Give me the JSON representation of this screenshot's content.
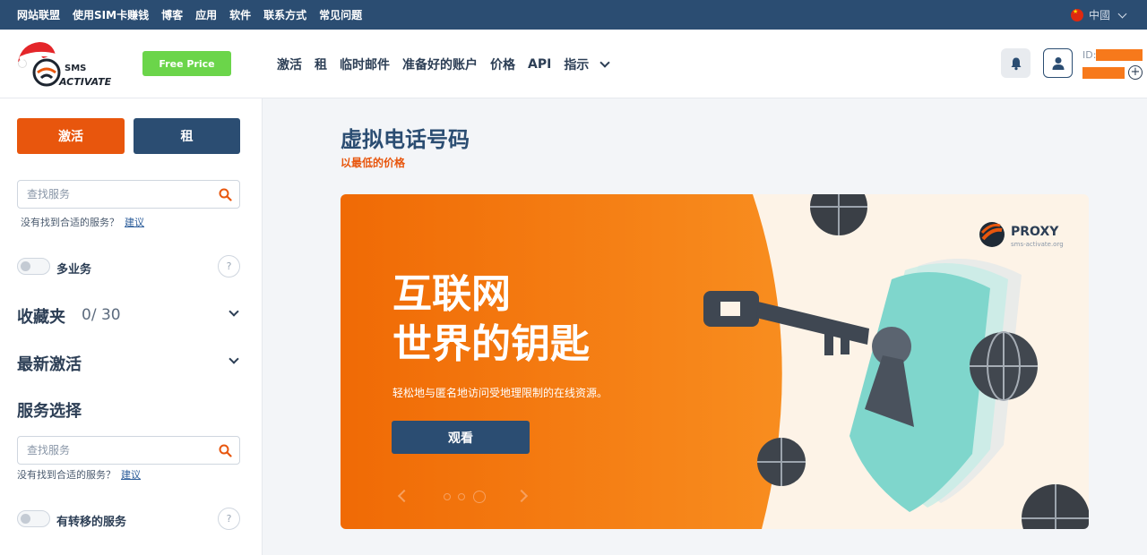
{
  "topbar": {
    "links": [
      "网站联盟",
      "使用SIM卡赚钱",
      "博客",
      "应用",
      "软件",
      "联系方式",
      "常见问题"
    ],
    "language": "中國"
  },
  "header": {
    "logo_text_top": "SMS",
    "logo_text_bottom": "ACTIVATE",
    "free_price_label": "Free Price",
    "nav": [
      "激活",
      "租",
      "临时邮件",
      "准备好的账户",
      "价格",
      "API",
      "指示"
    ],
    "id_label": "ID:",
    "plus_label": "+"
  },
  "sidebar": {
    "activate_label": "激活",
    "rent_label": "租",
    "search1_placeholder": "查找服务",
    "hint_text": "没有找到合适的服务？",
    "hint_link": "建议",
    "multi_service_label": "多业务",
    "help_label": "?",
    "favorites_title": "收藏夹",
    "favorites_count": "0/ 30",
    "recent_title": "最新激活",
    "select_title": "服务选择",
    "search2_placeholder": "查找服务",
    "hint2_text": "没有找到合适的服务？",
    "hint2_link": "建议",
    "forwarding_label": "有转移的服务"
  },
  "main": {
    "title": "虚拟电话号码",
    "subtitle": "以最低的价格",
    "banner": {
      "heading_line1": "互联网",
      "heading_line2": "世界的钥匙",
      "description": "轻松地与匿名地访问受地理限制的在线资源。",
      "button_label": "观看",
      "proxy_name": "PROXY",
      "proxy_site": "sms-activate.org"
    }
  },
  "colors": {
    "navy": "#2b4d72",
    "orange": "#e8560d",
    "green": "#6bd54a",
    "accent_orange": "#f7791b"
  }
}
